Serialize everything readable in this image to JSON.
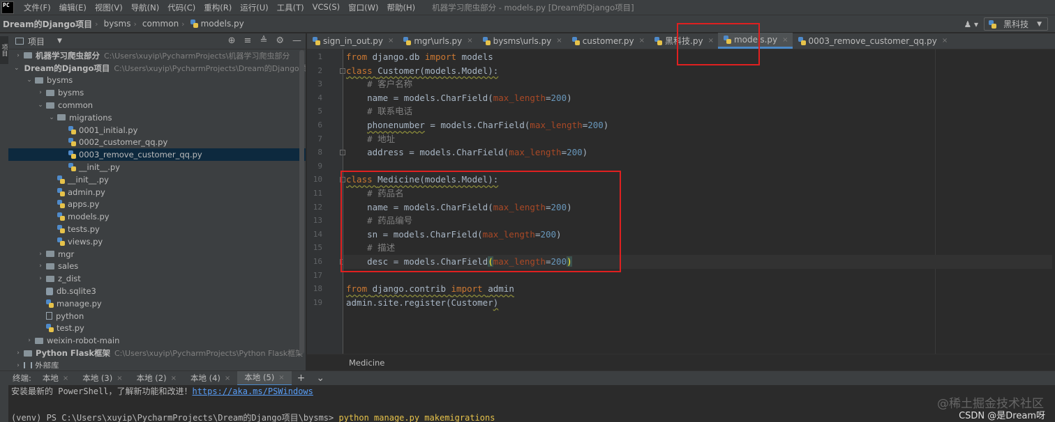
{
  "app": {
    "logo": "PC",
    "window_title": "机器学习爬虫部分 - models.py [Dream的Django项目]"
  },
  "menu": [
    "文件(F)",
    "编辑(E)",
    "视图(V)",
    "导航(N)",
    "代码(C)",
    "重构(R)",
    "运行(U)",
    "工具(T)",
    "VCS(S)",
    "窗口(W)",
    "帮助(H)"
  ],
  "breadcrumb": [
    "Dream的Django项目",
    "bysms",
    "common",
    "models.py"
  ],
  "toolbar": {
    "user_icon": "user-icon",
    "run_config": "黑科技"
  },
  "left_strip": {
    "tab": "项目"
  },
  "project_panel": {
    "title": "项目",
    "tree": [
      {
        "label": "机器学习爬虫部分",
        "path": "C:\\Users\\xuyip\\PycharmProjects\\机器学习爬虫部分",
        "depth": 0,
        "arrow": "›",
        "icon": "folder",
        "bold": true
      },
      {
        "label": "Dream的Django项目",
        "path": "C:\\Users\\xuyip\\PycharmProjects\\Dream的Django项",
        "depth": 0,
        "arrow": "⌄",
        "icon": "folder",
        "bold": true
      },
      {
        "label": "bysms",
        "path": "",
        "depth": 1,
        "arrow": "⌄",
        "icon": "folder"
      },
      {
        "label": "bysms",
        "path": "",
        "depth": 2,
        "arrow": "›",
        "icon": "folder"
      },
      {
        "label": "common",
        "path": "",
        "depth": 2,
        "arrow": "⌄",
        "icon": "folder"
      },
      {
        "label": "migrations",
        "path": "",
        "depth": 3,
        "arrow": "⌄",
        "icon": "folder"
      },
      {
        "label": "0001_initial.py",
        "path": "",
        "depth": 4,
        "arrow": "",
        "icon": "py"
      },
      {
        "label": "0002_customer_qq.py",
        "path": "",
        "depth": 4,
        "arrow": "",
        "icon": "py"
      },
      {
        "label": "0003_remove_customer_qq.py",
        "path": "",
        "depth": 4,
        "arrow": "",
        "icon": "py",
        "selected": true
      },
      {
        "label": "__init__.py",
        "path": "",
        "depth": 4,
        "arrow": "",
        "icon": "py"
      },
      {
        "label": "__init__.py",
        "path": "",
        "depth": 3,
        "arrow": "",
        "icon": "py"
      },
      {
        "label": "admin.py",
        "path": "",
        "depth": 3,
        "arrow": "",
        "icon": "py"
      },
      {
        "label": "apps.py",
        "path": "",
        "depth": 3,
        "arrow": "",
        "icon": "py"
      },
      {
        "label": "models.py",
        "path": "",
        "depth": 3,
        "arrow": "",
        "icon": "py"
      },
      {
        "label": "tests.py",
        "path": "",
        "depth": 3,
        "arrow": "",
        "icon": "py"
      },
      {
        "label": "views.py",
        "path": "",
        "depth": 3,
        "arrow": "",
        "icon": "py"
      },
      {
        "label": "mgr",
        "path": "",
        "depth": 2,
        "arrow": "›",
        "icon": "folder"
      },
      {
        "label": "sales",
        "path": "",
        "depth": 2,
        "arrow": "›",
        "icon": "folder"
      },
      {
        "label": "z_dist",
        "path": "",
        "depth": 2,
        "arrow": "›",
        "icon": "folder"
      },
      {
        "label": "db.sqlite3",
        "path": "",
        "depth": 2,
        "arrow": "",
        "icon": "db"
      },
      {
        "label": "manage.py",
        "path": "",
        "depth": 2,
        "arrow": "",
        "icon": "py"
      },
      {
        "label": "python",
        "path": "",
        "depth": 2,
        "arrow": "",
        "icon": "txt"
      },
      {
        "label": "test.py",
        "path": "",
        "depth": 2,
        "arrow": "",
        "icon": "py"
      },
      {
        "label": "weixin-robot-main",
        "path": "",
        "depth": 1,
        "arrow": "›",
        "icon": "folder"
      },
      {
        "label": "Python Flask框架",
        "path": "C:\\Users\\xuyip\\PycharmProjects\\Python Flask框架",
        "depth": 0,
        "arrow": "›",
        "icon": "folder",
        "bold": true
      },
      {
        "label": "外部库",
        "path": "",
        "depth": 0,
        "arrow": "›",
        "icon": "lib"
      }
    ]
  },
  "editor_tabs": [
    {
      "label": "sign_in_out.py",
      "active": false
    },
    {
      "label": "mgr\\urls.py",
      "active": false
    },
    {
      "label": "bysms\\urls.py",
      "active": false
    },
    {
      "label": "customer.py",
      "active": false
    },
    {
      "label": "黑科技.py",
      "active": false
    },
    {
      "label": "models.py",
      "active": true
    },
    {
      "label": "0003_remove_customer_qq.py",
      "active": false
    }
  ],
  "code_lines": [
    [
      [
        "kw",
        "from "
      ],
      [
        "",
        "django.db "
      ],
      [
        "kw",
        "import "
      ],
      [
        "",
        "models"
      ]
    ],
    [
      [
        "kw warn",
        "class "
      ],
      [
        "warn",
        "Customer(models.Model):"
      ]
    ],
    [
      [
        "",
        "    "
      ],
      [
        "cm",
        "# 客户名称"
      ]
    ],
    [
      [
        "",
        "    name = models.CharField("
      ],
      [
        "pm",
        "max_length"
      ],
      [
        "",
        "="
      ],
      [
        "num",
        "200"
      ],
      [
        "",
        ")"
      ]
    ],
    [
      [
        "",
        "    "
      ],
      [
        "cm",
        "# 联系电话"
      ]
    ],
    [
      [
        "",
        "    "
      ],
      [
        "warn",
        "phonenumber"
      ],
      [
        "",
        " = models.CharField("
      ],
      [
        "pm",
        "max_length"
      ],
      [
        "",
        "="
      ],
      [
        "num",
        "200"
      ],
      [
        "",
        ")"
      ]
    ],
    [
      [
        "",
        "    "
      ],
      [
        "cm",
        "# 地址"
      ]
    ],
    [
      [
        "",
        "    address = models.CharField("
      ],
      [
        "pm",
        "max_length"
      ],
      [
        "",
        "="
      ],
      [
        "num",
        "200"
      ],
      [
        "",
        ")"
      ]
    ],
    [],
    [
      [
        "kw warn",
        "class "
      ],
      [
        "warn",
        "Medicine(models.Model):"
      ]
    ],
    [
      [
        "",
        "    "
      ],
      [
        "cm",
        "# 药品名"
      ]
    ],
    [
      [
        "",
        "    name = models.CharField("
      ],
      [
        "pm",
        "max_length"
      ],
      [
        "",
        "="
      ],
      [
        "num",
        "200"
      ],
      [
        "",
        ")"
      ]
    ],
    [
      [
        "",
        "    "
      ],
      [
        "cm",
        "# 药品编号"
      ]
    ],
    [
      [
        "",
        "    sn = models.CharField("
      ],
      [
        "pm",
        "max_length"
      ],
      [
        "",
        "="
      ],
      [
        "num",
        "200"
      ],
      [
        "",
        ")"
      ]
    ],
    [
      [
        "",
        "    "
      ],
      [
        "cm",
        "# 描述"
      ]
    ],
    [
      [
        "",
        "    desc = models.CharField"
      ],
      [
        "bracket-hl",
        "("
      ],
      [
        "pm",
        "max_length"
      ],
      [
        "",
        "="
      ],
      [
        "num",
        "200"
      ],
      [
        "bracket-hl",
        ")"
      ]
    ],
    [],
    [
      [
        "kw warn",
        "from "
      ],
      [
        "warn",
        "django.contrib "
      ],
      [
        "kw warn",
        "import "
      ],
      [
        "warn",
        "admin"
      ]
    ],
    [
      [
        "",
        "admin.site.register(Customer"
      ],
      [
        "warn",
        ")"
      ]
    ]
  ],
  "current_line": 16,
  "editor_breadcrumb": "Medicine",
  "terminal": {
    "label": "终端:",
    "tabs": [
      {
        "label": "本地",
        "active": false
      },
      {
        "label": "本地 (3)",
        "active": false
      },
      {
        "label": "本地 (2)",
        "active": false
      },
      {
        "label": "本地 (4)",
        "active": false
      },
      {
        "label": "本地 (5)",
        "active": true
      }
    ],
    "add_button": "+",
    "more_button": "⌄",
    "line1_text": "安装最新的 PowerShell，了解新功能和改进！",
    "line1_link": "https://aka.ms/PSWindows",
    "line2_prompt": "(venv) PS C:\\Users\\xuyip\\PycharmProjects\\Dream的Django项目\\bysms> ",
    "line2_cmd": "python manage.py makemigrations"
  },
  "watermark": {
    "line1": "@稀土掘金技术社区",
    "line2": "CSDN @是Dream呀"
  },
  "colors": {
    "highlight_box": "#e02020",
    "accent": "#4a88c7"
  }
}
